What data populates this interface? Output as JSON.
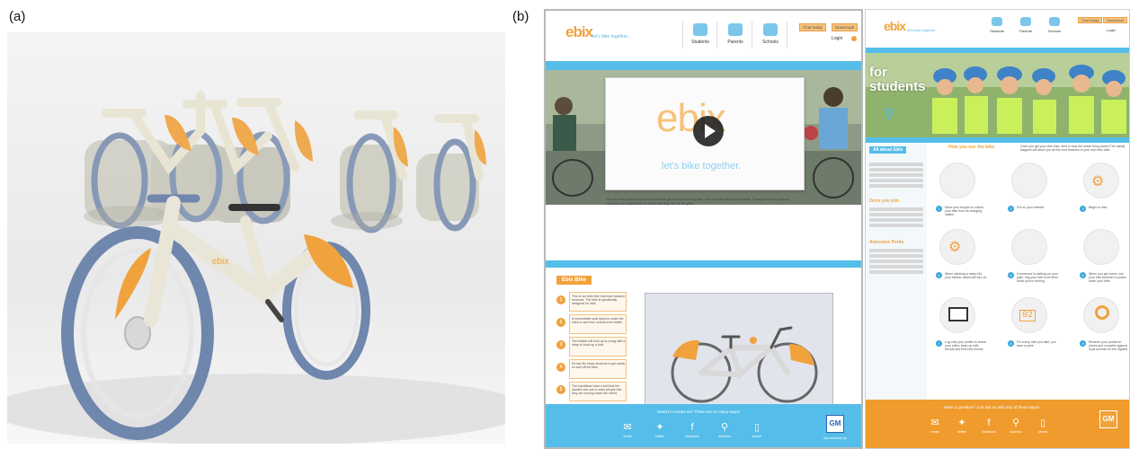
{
  "labels": {
    "a": "(a)",
    "b": "(b)"
  },
  "brand": {
    "logo": "ebix",
    "tagline_small": "let's bike together...",
    "video_tagline": "let's bike together."
  },
  "nav": {
    "students": "Students",
    "parents": "Parents",
    "schools": "Schools"
  },
  "header_buttons": {
    "left": "Chat today",
    "right": "Download!"
  },
  "login": "Login",
  "left_page": {
    "intro": "Ebix is a non profit program that partners with schools to bring safe + fun on-street biking to students. Through the ebix program, students are responsible for a bike that they use for the year...",
    "bike_section_title": "Ebix Bike",
    "steps": [
      {
        "num": "1",
        "text": "This is our ebix bike that each student reserves. The bike is specifically designed for kids."
      },
      {
        "num": "2",
        "text": "A comfortable seat helps to make the rides to and from school even better."
      },
      {
        "num": "3",
        "text": "The basket will hold up to a bag with a strap to hook up a lock."
      },
      {
        "num": "4",
        "text": "No bar fits helps students to get easily on and off the bike."
      },
      {
        "num": "5",
        "text": "The handlebar have a bell that the student can use to warn people that they are coming down the street."
      }
    ],
    "footer_heading": "Need to contact us? There are so many ways!",
    "footer_items": [
      "email",
      "twitter",
      "facebook",
      "address",
      "phone"
    ],
    "sponsor": "GM",
    "sponsor_caption": "Sponsorship by"
  },
  "right_page": {
    "hero_title_1": "for",
    "hero_title_2": "students",
    "sidebar_heading": "All about Ebix",
    "sidebar_sub_1": "Once you join",
    "sidebar_sub_2": "Awesome Perks",
    "section_heading": "How you use the bike",
    "section_note": "Once you get your ebix bike, here is how the whole thing works! The handy diagram will show you all the cool features of your own ebix bike.",
    "steps": [
      {
        "num": "1",
        "text": "Move your bicycle to unlock your bike from its charging station"
      },
      {
        "num": "2",
        "text": "Put on your helmet!"
      },
      {
        "num": "3",
        "text": "Begin to ride!"
      },
      {
        "num": "4",
        "text": "When climbing a steep hill, your electric assist will turn on"
      },
      {
        "num": "5",
        "text": "If someone is walking on your path, ring your bell to let them know you're coming"
      },
      {
        "num": "6",
        "text": "When you get home, use your ebix bracelet to power down your bike"
      },
      {
        "num": "7",
        "text": "Log onto your profile to check your miles, keep up with friends and find ebix events"
      },
      {
        "num": "8",
        "text": "For every mile you bike, you earn a point"
      },
      {
        "num": "9",
        "text": "Redeem your points for prizes and compete against local schools for the highest total mileage!"
      }
    ],
    "counter": "02",
    "footer_heading": "Have a question? Just ask us with any of these ways!",
    "footer_items": [
      "email",
      "twitter",
      "facebook",
      "address",
      "phone"
    ],
    "sponsor": "GM"
  },
  "colors": {
    "orange": "#f0a23d",
    "blue": "#55bde9",
    "bike_frame": "#e9e6d8"
  }
}
